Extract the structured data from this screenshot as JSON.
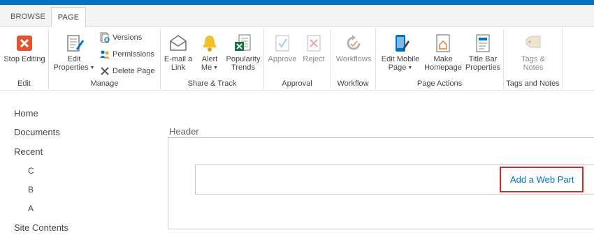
{
  "tabs": {
    "browse": "BROWSE",
    "page": "PAGE"
  },
  "ribbon": {
    "edit": {
      "stop_editing": "Stop Editing",
      "group": "Edit"
    },
    "manage": {
      "edit_properties": "Edit",
      "edit_properties_2": "Properties",
      "versions": "Versions",
      "permissions": "Permissions",
      "delete_page": "Delete Page",
      "group": "Manage"
    },
    "share": {
      "email_1": "E-mail a",
      "email_2": "Link",
      "alert_1": "Alert",
      "alert_2": "Me",
      "pop_1": "Popularity",
      "pop_2": "Trends",
      "group": "Share & Track"
    },
    "approval": {
      "approve": "Approve",
      "reject": "Reject",
      "group": "Approval"
    },
    "workflow": {
      "workflows": "Workflows",
      "group": "Workflow"
    },
    "page_actions": {
      "mobile_1": "Edit Mobile",
      "mobile_2": "Page",
      "home_1": "Make",
      "home_2": "Homepage",
      "title_1": "Title Bar",
      "title_2": "Properties",
      "group": "Page Actions"
    },
    "tags": {
      "tags_1": "Tags &",
      "tags_2": "Notes",
      "group": "Tags and Notes"
    }
  },
  "nav": {
    "home": "Home",
    "documents": "Documents",
    "recent": "Recent",
    "c": "C",
    "b": "B",
    "a": "A",
    "site_contents": "Site Contents"
  },
  "zone": {
    "title": "Header",
    "add_web_part": "Add a Web Part"
  },
  "colors": {
    "accent": "#0072c6",
    "highlight": "#e0252b",
    "stop": "#e0552e"
  }
}
